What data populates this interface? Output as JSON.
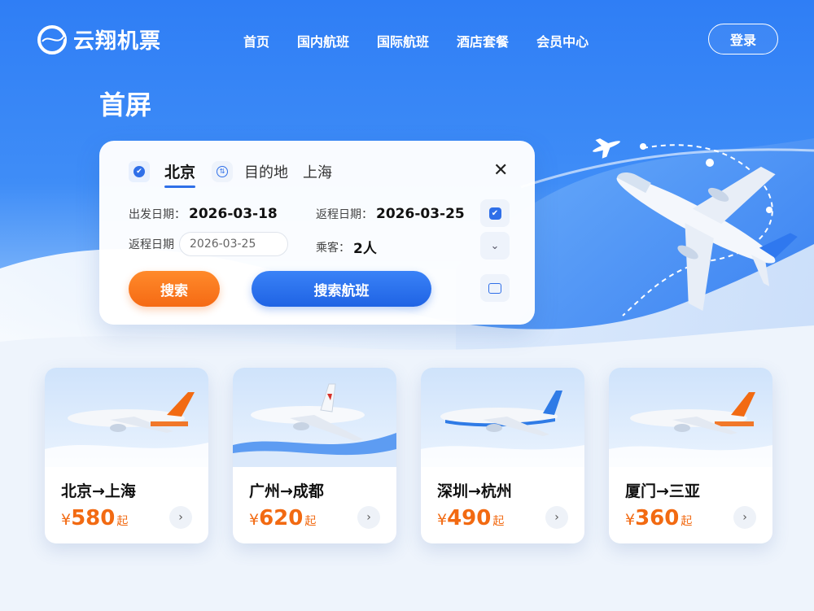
{
  "header": {
    "brand": "云翔机票",
    "nav": [
      "首页",
      "国内航班",
      "国际航班",
      "酒店套餐",
      "会员中心"
    ],
    "login_label": "登录"
  },
  "page": {
    "title": "首屏"
  },
  "search": {
    "from_city": "北京",
    "destination_label": "目的地",
    "to_city": "上海",
    "depart_label": "出发日期：",
    "depart_value": "2026-03-18",
    "return_label": "返程日期：",
    "return_value": "2026-03-25",
    "return_input_label": "返程日期",
    "return_input_value": "2026-03-25",
    "passengers_label": "乘客：",
    "passengers_value": "2人",
    "search_button": "搜索",
    "search_flight_button": "搜索航班"
  },
  "deals": [
    {
      "route": "北京→上海",
      "currency": "¥",
      "price": "580",
      "suffix": "起",
      "tail_color": "#f26a12"
    },
    {
      "route": "广州→成都",
      "currency": "¥",
      "price": "620",
      "suffix": "起",
      "tail_color": "#ffffff"
    },
    {
      "route": "深圳→杭州",
      "currency": "¥",
      "price": "490",
      "suffix": "起",
      "tail_color": "#2f7be6"
    },
    {
      "route": "厦门→三亚",
      "currency": "¥",
      "price": "360",
      "suffix": "起",
      "tail_color": "#f26a12"
    }
  ],
  "colors": {
    "primary": "#2f6fe8",
    "accent": "#f56a14"
  }
}
